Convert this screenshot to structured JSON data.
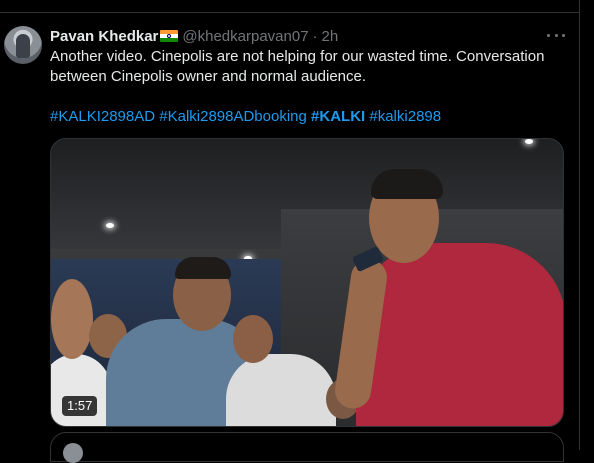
{
  "tweet": {
    "author": {
      "display_name": "Pavan Khedkar",
      "flag_icon": "india-flag-icon",
      "handle": "@khedkarpavan07",
      "separator": "·",
      "time": "2h"
    },
    "more_icon": "more-horizontal-icon",
    "text_line1": "Another video. Cinepolis are not helping for our wasted time. Conversation",
    "text_line2": "between Cinepolis owner and normal audience.",
    "hashtags": [
      {
        "text": "#KALKI2898AD",
        "bold": false
      },
      {
        "text": "#Kalki2898ADbooking",
        "bold": false
      },
      {
        "text": "#KALKI",
        "bold": true
      },
      {
        "text": "#kalki2898",
        "bold": false
      }
    ],
    "video": {
      "duration": "1:57"
    }
  },
  "colors": {
    "background": "#000000",
    "text": "#e7e9ea",
    "secondary": "#71767b",
    "link": "#1d9bf0",
    "border": "#2f3336"
  }
}
